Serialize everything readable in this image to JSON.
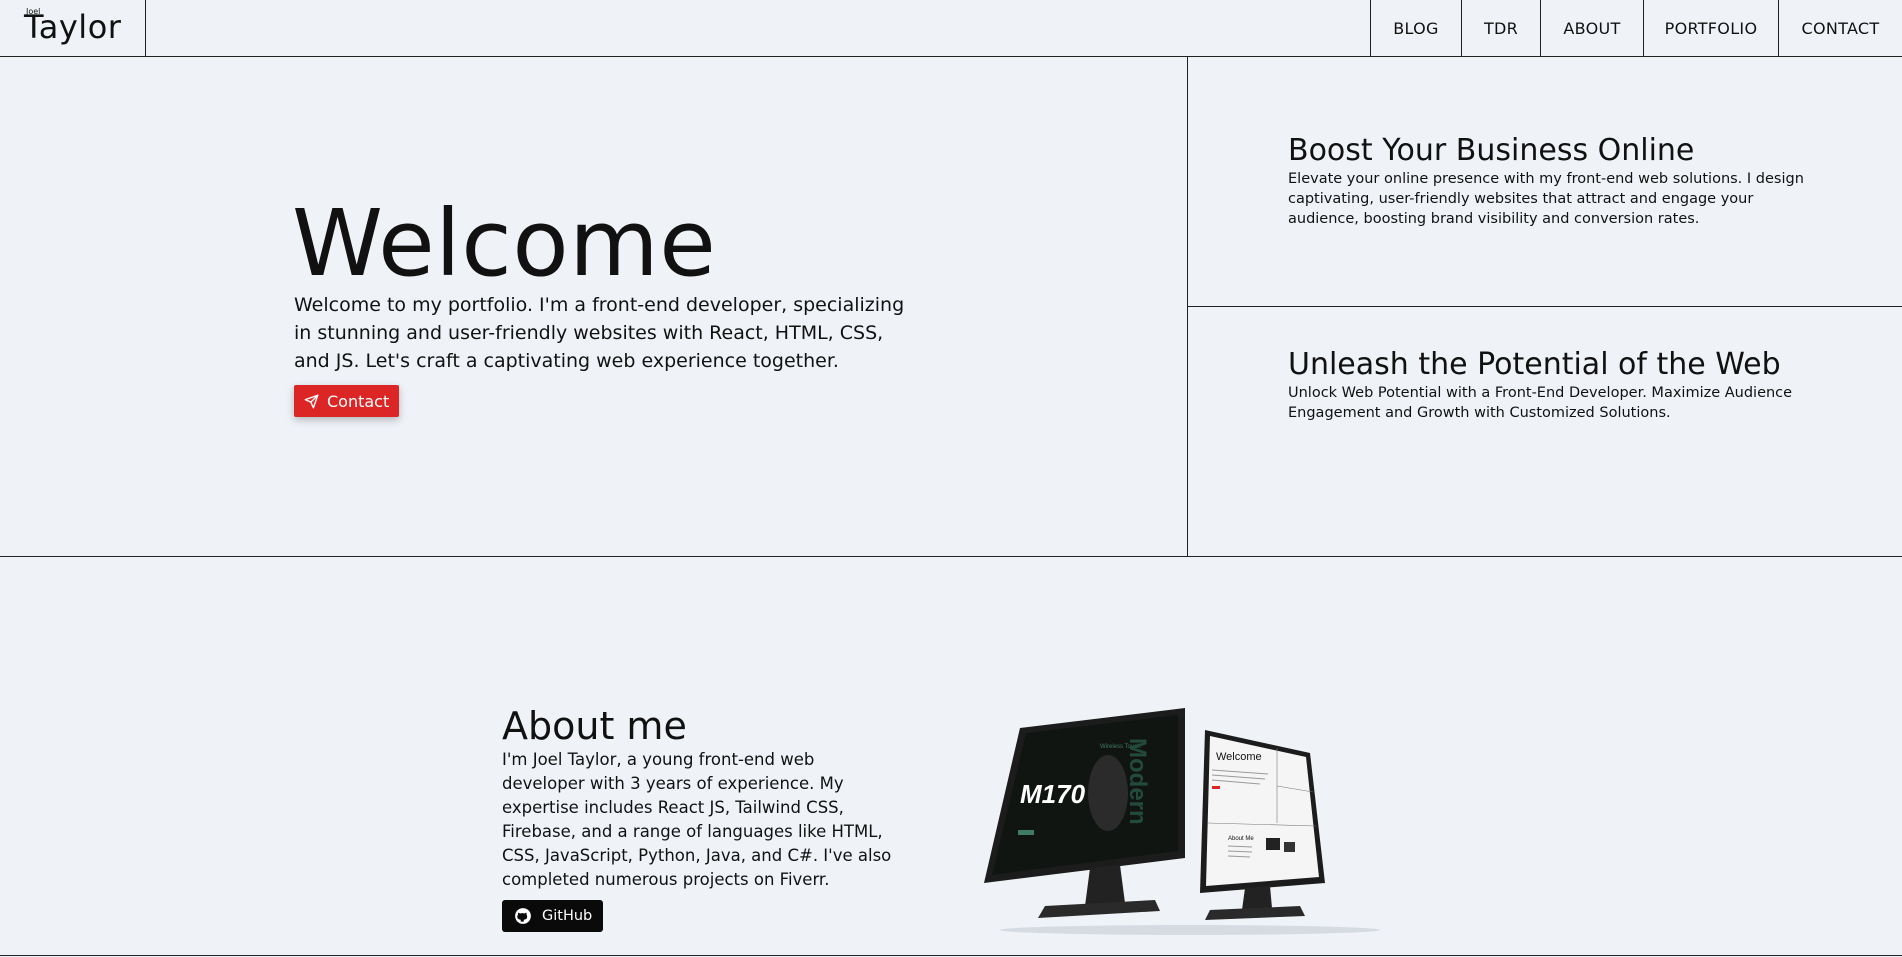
{
  "header": {
    "logo_small": "Joel",
    "logo_big": "Taylor",
    "nav": [
      "BLOG",
      "TDR",
      "ABOUT",
      "PORTFOLIO",
      "CONTACT"
    ]
  },
  "hero": {
    "title": "Welcome",
    "text": "Welcome to my portfolio. I'm a front-end developer, specializing in stunning and user-friendly websites with React, HTML, CSS, and JS. Let's craft a captivating web experience together.",
    "contact_label": "Contact"
  },
  "cards": [
    {
      "title": "Boost Your Business Online",
      "text": "Elevate your online presence with my front-end web solutions. I design captivating, user-friendly websites that attract and engage your audience, boosting brand visibility and conversion rates."
    },
    {
      "title": "Unleash the Potential of the Web",
      "text": "Unlock Web Potential with a Front-End Developer. Maximize Audience Engagement and Growth with Customized Solutions."
    }
  ],
  "about": {
    "title": "About me",
    "text": "I'm Joel Taylor, a young front-end web developer with 3 years of experience. My expertise includes React JS, Tailwind CSS, Firebase, and a range of languages like HTML, CSS, JavaScript, Python, Java, and C#. I've also completed numerous projects on Fiverr.",
    "github_label": "GitHub"
  },
  "mockup": {
    "left_screen_title": "M170",
    "left_screen_side": "Modern",
    "left_screen_label": "Wireless Touch",
    "right_screen_title": "Welcome",
    "right_screen_about": "About Me"
  },
  "colors": {
    "background": "#eff3f8",
    "accent": "#dc2626",
    "dark": "#0a0a0a",
    "border": "#222222"
  }
}
